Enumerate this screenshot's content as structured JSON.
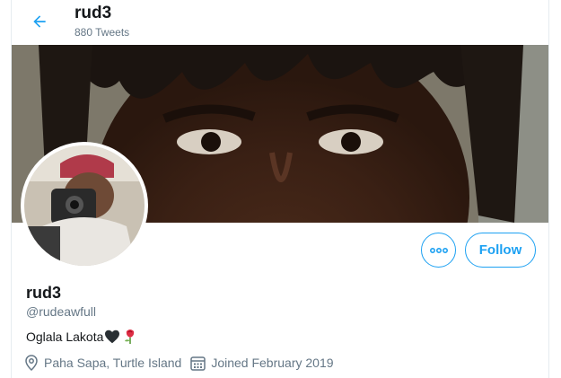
{
  "header": {
    "name": "rud3",
    "tweet_count": "880 Tweets"
  },
  "actions": {
    "more_icon": "more-horizontal-icon",
    "follow_label": "Follow"
  },
  "profile": {
    "display_name": "rud3",
    "handle": "@rudeawfull",
    "bio_text": "Oglala Lakota",
    "location": "Paha Sapa, Turtle Island",
    "joined": "Joined February 2019"
  },
  "colors": {
    "accent": "#1da1f2",
    "secondary_text": "#657786",
    "primary_text": "#14171a"
  }
}
